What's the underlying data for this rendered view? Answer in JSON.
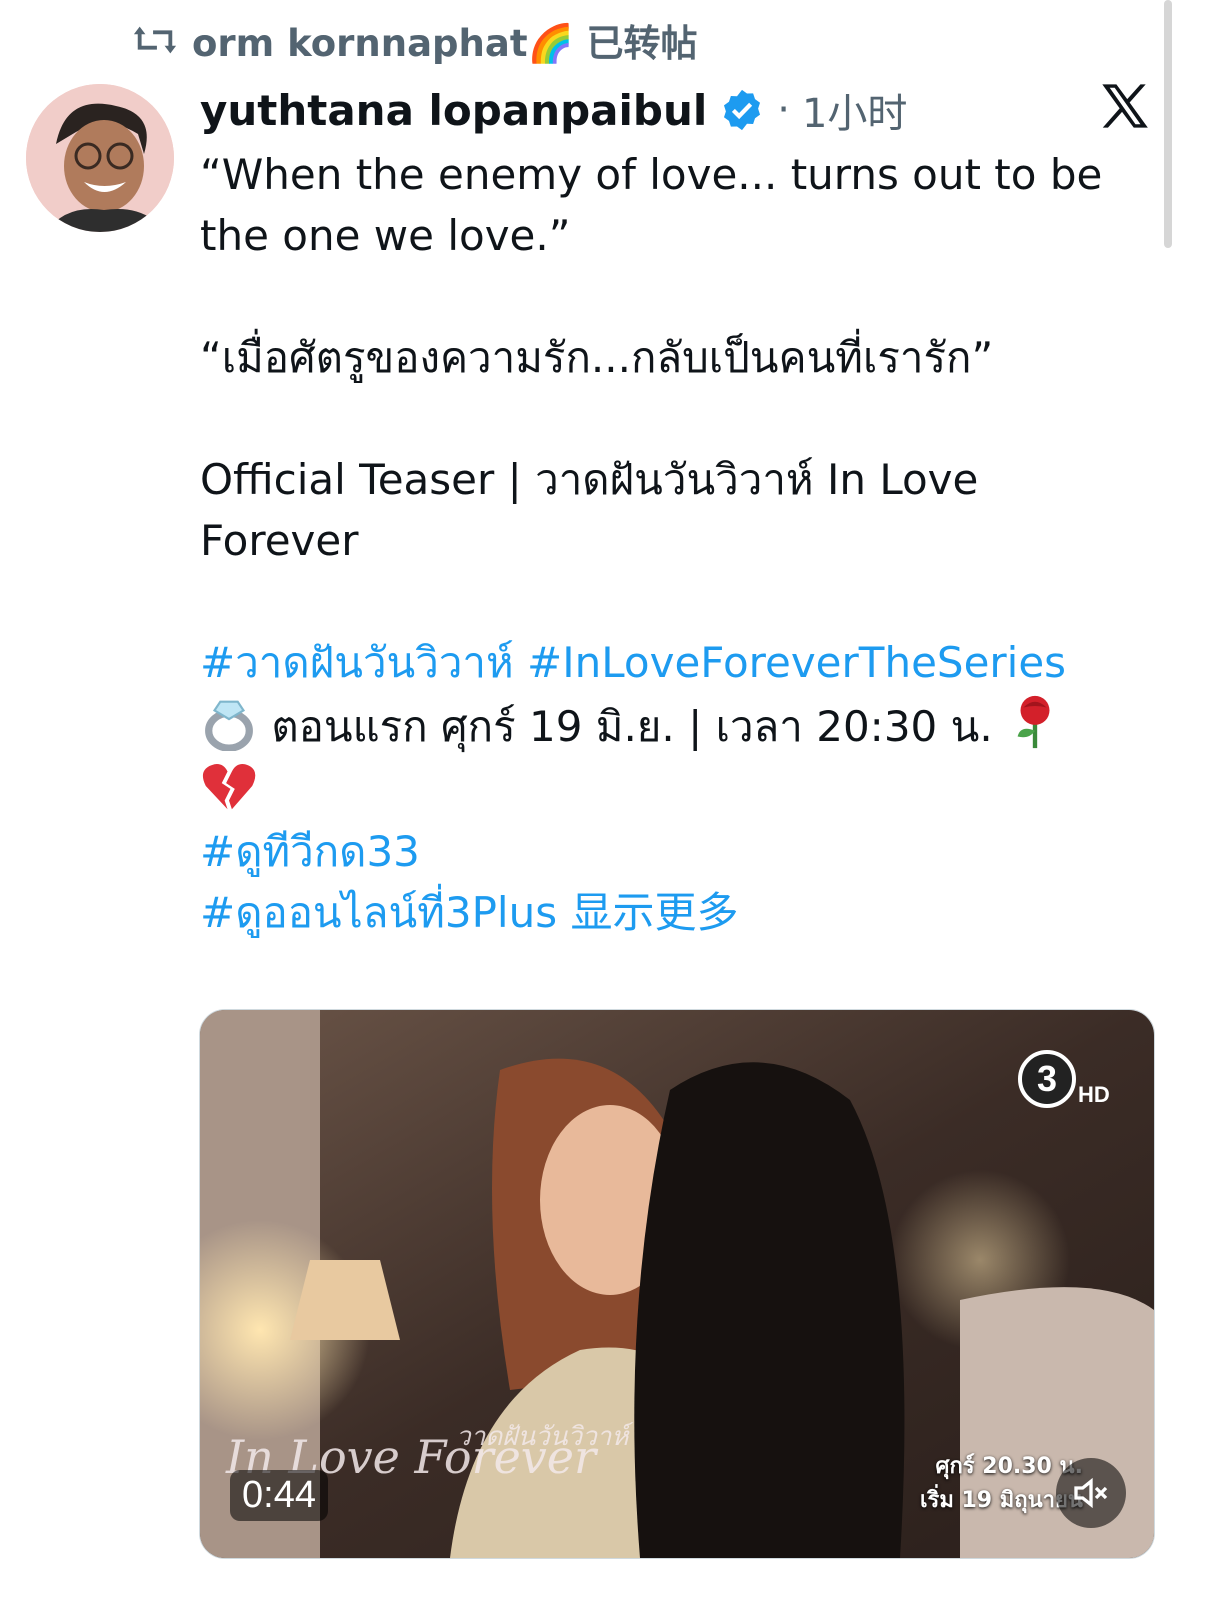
{
  "repost": {
    "text": "orm kornnaphat🌈 已转帖",
    "icon": "repost-icon"
  },
  "author": {
    "display_name": "yuthtana lopanpaibul",
    "verified": true,
    "separator": "·",
    "time": "1小时",
    "avatar_icon": "user-avatar"
  },
  "platform_icon": "x-logo-icon",
  "post": {
    "line1": "“When the enemy of love... turns out to be the one we love.”",
    "line2": "“เมื่อศัตรูของความรัก...กลับเป็นคนที่เรารัก”",
    "line3": "Official Teaser | วาดฝันวันวิวาห์ In Love Forever",
    "hashtags_1": "#วาดฝันวันวิวาห์ #InLoveForeverTheSeries",
    "airing": "ตอนแรก ศุกร์ 19 มิ.ย. | เวลา 20:30 น.",
    "hashtag_2": "#ดูทีวีกด33",
    "hashtag_3": "#ดูออนไลน์ที่3Plus",
    "show_more": "显示更多"
  },
  "emojis": [
    "ring-icon",
    "rose-icon",
    "broken-heart-icon"
  ],
  "video": {
    "duration": "0:44",
    "channel_logo_number": "3",
    "channel_logo_suffix": "HD",
    "promo_line1": "ศุกร์ 20.30 น.",
    "promo_line2": "เริ่ม 19 มิถุนายน",
    "title_art": "In Love Forever",
    "title_art_thai": "วาดฝันวันวิวาห์",
    "mute_icon": "muted-speaker-icon"
  }
}
